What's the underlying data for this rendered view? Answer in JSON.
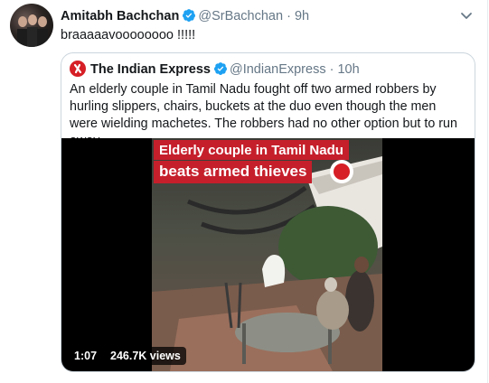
{
  "tweet": {
    "author_name": "Amitabh Bachchan",
    "author_handle": "@SrBachchan",
    "separator": "·",
    "time": "9h",
    "text": "braaaaavoooooooo !!!!!"
  },
  "quoted_tweet": {
    "author_name": "The Indian Express",
    "author_handle": "@IndianExpress",
    "separator": "·",
    "time": "10h",
    "text": "An elderly couple in Tamil Nadu fought off two armed robbers by hurling slippers, chairs, buckets at the duo even though the men were wielding machetes. The robbers had no other option but to run away."
  },
  "video": {
    "overlay_line1": "Elderly couple in Tamil Nadu",
    "overlay_line2": "beats armed thieves",
    "duration": "1:07",
    "views": "246.7K views"
  },
  "icons": {
    "verified": "verified-badge-icon",
    "caret": "chevron-down-icon",
    "publisher_logo": "indian-express-logo-icon"
  },
  "colors": {
    "verified_blue": "#1da1f2",
    "secondary_text": "#657786",
    "brand_red": "#d61f26"
  }
}
